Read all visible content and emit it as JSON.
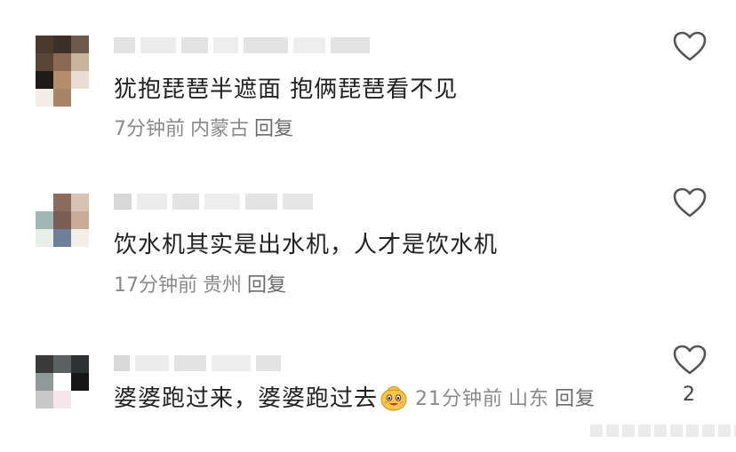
{
  "comments": [
    {
      "text": "犹抱琵琶半遮面 抱俩琵琶看不见",
      "time": "7分钟前",
      "location": "内蒙古",
      "reply_label": "回复",
      "like_icon": "heart-outline-icon"
    },
    {
      "text": "饮水机其实是出水机，人才是饮水机",
      "time": "17分钟前",
      "location": "贵州",
      "reply_label": "回复",
      "like_icon": "heart-outline-icon"
    },
    {
      "text": "婆婆跑过来，婆婆跑过去",
      "emoji": "smiling-pouch-emoji",
      "time": "21分钟前",
      "location": "山东",
      "reply_label": "回复",
      "like_count": "2",
      "like_icon": "heart-outline-icon"
    }
  ],
  "colors": {
    "text": "#222222",
    "meta": "#8a8a8a",
    "icon": "#555555"
  }
}
